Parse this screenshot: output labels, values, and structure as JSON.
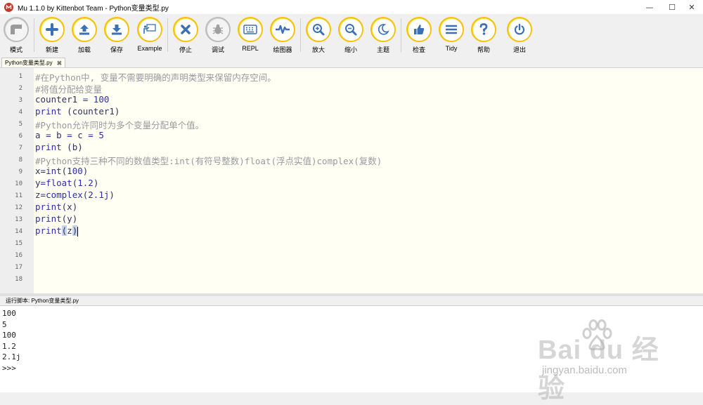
{
  "window": {
    "title": "Mu 1.1.0 by Kittenbot Team - Python变量类型.py",
    "minimize": "—",
    "maximize": "☐",
    "close": "✕"
  },
  "toolbar": {
    "mode": "模式",
    "new": "新建",
    "load": "加载",
    "save": "保存",
    "example": "Example",
    "stop": "停止",
    "debug": "调试",
    "repl": "REPL",
    "plotter": "绘图器",
    "zoom_in": "放大",
    "zoom_out": "缩小",
    "theme": "主题",
    "check": "检查",
    "tidy": "Tidy",
    "help": "帮助",
    "quit": "退出"
  },
  "tab": {
    "label": "Python变量类型.py",
    "close": "✖"
  },
  "editor": {
    "lines": [
      [
        {
          "t": "#在Python中, 变量不需要明确的声明类型来保留内存空间。",
          "c": "cm"
        }
      ],
      [
        {
          "t": "#将值分配给变量",
          "c": "cm"
        }
      ],
      [
        {
          "t": "counter1 ",
          "c": "tx"
        },
        {
          "t": "=",
          "c": "op"
        },
        {
          "t": " 100",
          "c": "num"
        }
      ],
      [
        {
          "t": "print",
          "c": "kw"
        },
        {
          "t": " (counter1)",
          "c": "tx"
        }
      ],
      [
        {
          "t": "#Python允许同时为多个变量分配单个值。",
          "c": "cm"
        }
      ],
      [
        {
          "t": "a ",
          "c": "tx"
        },
        {
          "t": "=",
          "c": "op"
        },
        {
          "t": " b ",
          "c": "tx"
        },
        {
          "t": "=",
          "c": "op"
        },
        {
          "t": " c ",
          "c": "tx"
        },
        {
          "t": "=",
          "c": "op"
        },
        {
          "t": " 5",
          "c": "num"
        }
      ],
      [
        {
          "t": "print",
          "c": "kw"
        },
        {
          "t": " (b)",
          "c": "tx"
        }
      ],
      [
        {
          "t": "#Python支持三种不同的数值类型:int(有符号整数)float(浮点实值)complex(复数)",
          "c": "cm"
        }
      ],
      [
        {
          "t": "x",
          "c": "tx"
        },
        {
          "t": "=",
          "c": "op"
        },
        {
          "t": "int",
          "c": "kw"
        },
        {
          "t": "(",
          "c": "tx"
        },
        {
          "t": "100",
          "c": "num"
        },
        {
          "t": ")",
          "c": "tx"
        }
      ],
      [
        {
          "t": "y",
          "c": "tx"
        },
        {
          "t": "=",
          "c": "op"
        },
        {
          "t": "float",
          "c": "kw"
        },
        {
          "t": "(",
          "c": "tx"
        },
        {
          "t": "1.2",
          "c": "num"
        },
        {
          "t": ")",
          "c": "tx"
        }
      ],
      [
        {
          "t": "z",
          "c": "tx"
        },
        {
          "t": "=",
          "c": "op"
        },
        {
          "t": "complex",
          "c": "kw"
        },
        {
          "t": "(",
          "c": "tx"
        },
        {
          "t": "2.1j",
          "c": "num"
        },
        {
          "t": ")",
          "c": "tx"
        }
      ],
      [
        {
          "t": "print",
          "c": "kw"
        },
        {
          "t": "(x)",
          "c": "tx"
        }
      ],
      [
        {
          "t": "print",
          "c": "kw"
        },
        {
          "t": "(y)",
          "c": "tx"
        }
      ],
      [
        {
          "t": "print",
          "c": "kw"
        },
        {
          "t": "(",
          "c": "paren-hl"
        },
        {
          "t": "z",
          "c": "tx"
        },
        {
          "t": ")",
          "c": "paren-hl"
        },
        {
          "t": "",
          "c": "cursor"
        }
      ],
      [],
      [],
      [],
      []
    ],
    "line_numbers": [
      "1",
      "2",
      "3",
      "4",
      "5",
      "6",
      "7",
      "8",
      "9",
      "10",
      "11",
      "12",
      "13",
      "14",
      "15",
      "16",
      "17",
      "18"
    ]
  },
  "output": {
    "header": "运行脚本: Python变量类型.py",
    "lines": [
      "100",
      "5",
      "100",
      "1.2",
      "2.1j",
      ">>>"
    ]
  },
  "watermark": {
    "brand": "Bai du 经验",
    "url": "jingyan.baidu.com"
  },
  "colors": {
    "accent": "#f4c20d",
    "button_fill": "#ffe14a",
    "editor_bg": "#fffff4",
    "keyword": "#2d2db0",
    "comment": "#9a9aa0"
  }
}
